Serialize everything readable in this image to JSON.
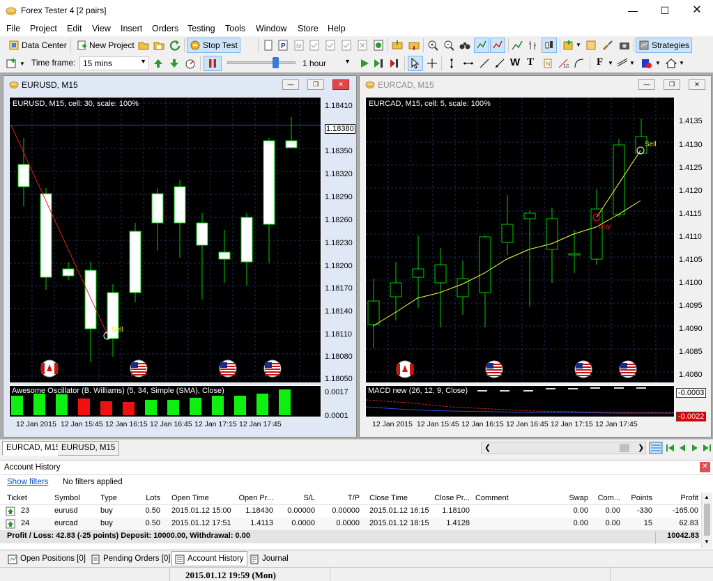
{
  "app": {
    "title": "Forex Tester 4  [2 pairs]"
  },
  "menu": [
    "File",
    "Project",
    "Edit",
    "View",
    "Insert",
    "Orders",
    "Testing",
    "Tools",
    "Window",
    "Store",
    "Help"
  ],
  "toolbar1": {
    "data_center": "Data Center",
    "new_project": "New Project",
    "stop_test": "Stop Test",
    "strategies": "Strategies"
  },
  "toolbar2": {
    "timeframe_label": "Time frame:",
    "timeframe_value": "15 mins",
    "speed_value": "1 hour"
  },
  "charts": {
    "eurusd": {
      "title": "EURUSD, M15",
      "info": "EURUSD, M15, cell: 30, scale: 100%",
      "price_labels": [
        "1.18410",
        "1.18380",
        "1.18350",
        "1.18320",
        "1.18290",
        "1.18260",
        "1.18230",
        "1.18200",
        "1.18170",
        "1.18140",
        "1.18110",
        "1.18080",
        "1.18050"
      ],
      "oscillator_title": "Awesome Oscillator (B. Williams) (5, 34, Simple (SMA), Close)",
      "osc_labels": [
        "0.0017",
        "0.0001"
      ],
      "time_labels": [
        "12 Jan 2015",
        "12 Jan 15:45",
        "12 Jan 16:15",
        "12 Jan 16:45",
        "12 Jan 17:15",
        "12 Jan 17:45"
      ],
      "sell_label": "Sell"
    },
    "eurcad": {
      "title": "EURCAD, M15",
      "info": "EURCAD, M15, cell: 5, scale: 100%",
      "price_labels": [
        "1.4135",
        "1.4130",
        "1.4125",
        "1.4120",
        "1.4115",
        "1.4110",
        "1.4105",
        "1.4100",
        "1.4095",
        "1.4090",
        "1.4085",
        "1.4080"
      ],
      "macd_title": "MACD new (26, 12, 9, Close)",
      "macd_labels": [
        "-0.0003",
        "-0.0022"
      ],
      "time_labels": [
        "12 Jan 2015",
        "12 Jan 15:45",
        "12 Jan 16:15",
        "12 Jan 16:45",
        "12 Jan 17:15",
        "12 Jan 17:45"
      ],
      "sell_label": "Sell",
      "buy_label": "Buy"
    }
  },
  "chart_tabs": [
    "EURCAD, M15",
    "EURUSD, M15"
  ],
  "history": {
    "title": "Account History",
    "show_filters": "Show filters",
    "filters_text": "No filters applied",
    "columns": [
      "Ticket",
      "Symbol",
      "Type",
      "Lots",
      "Open Time",
      "Open Pr...",
      "S/L",
      "T/P",
      "Close Time",
      "Close Pr...",
      "Comment",
      "Swap",
      "Com...",
      "Points",
      "Profit"
    ],
    "rows": [
      [
        "23",
        "eurusd",
        "buy",
        "0.50",
        "2015.01.12 15:00",
        "1.18430",
        "0.00000",
        "0.00000",
        "2015.01.12 16:15",
        "1.18100",
        "",
        "0.00",
        "0.00",
        "-330",
        "-165.00"
      ],
      [
        "24",
        "eurcad",
        "buy",
        "0.50",
        "2015.01.12 17:51",
        "1.4113",
        "0.0000",
        "0.0000",
        "2015.01.12 18:15",
        "1.4128",
        "",
        "0.00",
        "0.00",
        "15",
        "62.83"
      ]
    ],
    "summary": "Profit / Loss: 42.83 (-25 points) Deposit: 10000.00, Withdrawal: 0.00",
    "balance": "10042.83"
  },
  "bottom_tabs": [
    "Open Positions [0]",
    "Pending Orders [0]",
    "Account History",
    "Journal"
  ],
  "status": {
    "datetime": "2015.01.12 19:59 (Mon)"
  }
}
